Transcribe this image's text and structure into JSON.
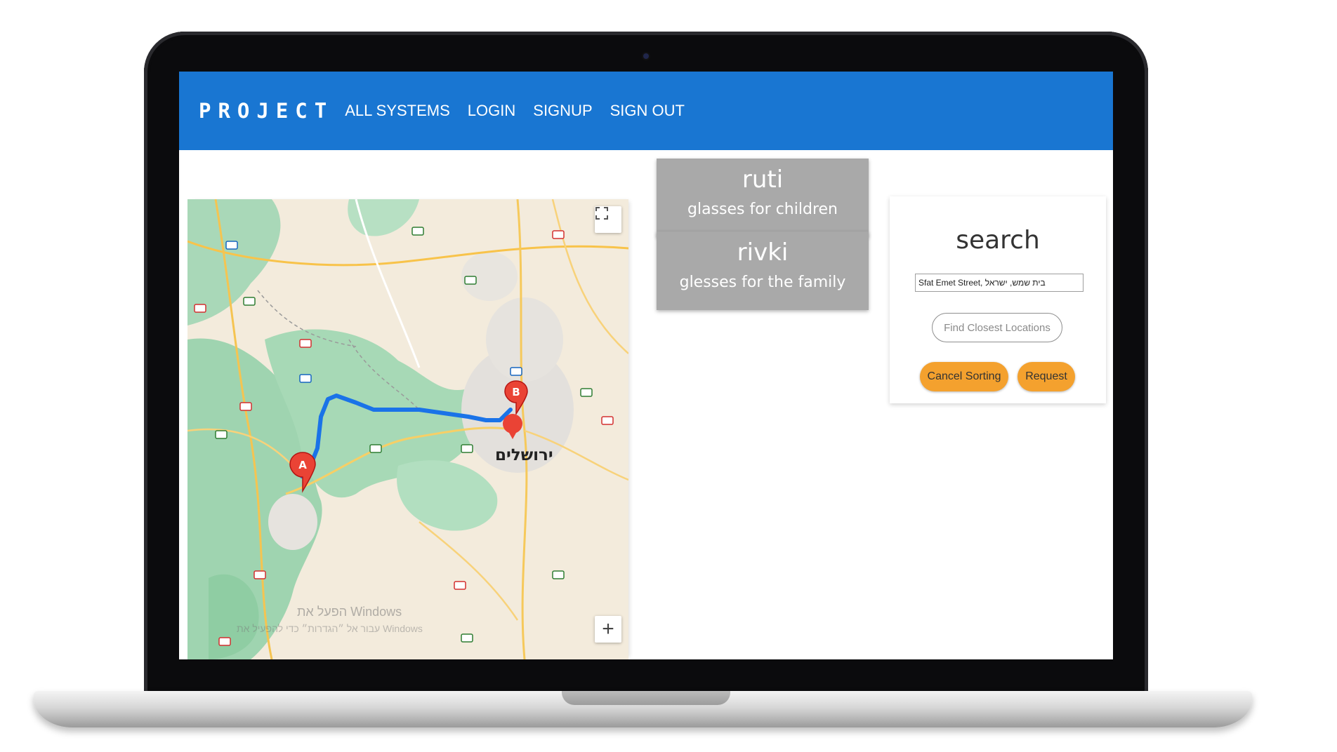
{
  "navbar": {
    "brand": "PROJECT",
    "links": [
      "ALL SYSTEMS",
      "LOGIN",
      "SIGNUP",
      "SIGN OUT"
    ],
    "background": "#1976d2"
  },
  "map": {
    "city_label": "ירושלים",
    "marker_a": "A",
    "marker_b": "B",
    "watermark_line1": "הפעל את Windows",
    "watermark_line2": "עבור אל ״הגדרות״ כדי להפעיל את Windows",
    "fullscreen_icon": "fullscreen-icon",
    "zoom_in": "+",
    "route_color": "#1a73e8"
  },
  "cards": [
    {
      "name": "ruti",
      "description": "glasses for children"
    },
    {
      "name": "rivki",
      "description": "glesses for the family"
    }
  ],
  "search": {
    "title": "search",
    "input_value": "Sfat Emet Street, בית שמש, ישראל",
    "find_button": "Find Closest Locations",
    "cancel_button": "Cancel Sorting",
    "request_button": "Request",
    "accent": "#f4a12e"
  }
}
